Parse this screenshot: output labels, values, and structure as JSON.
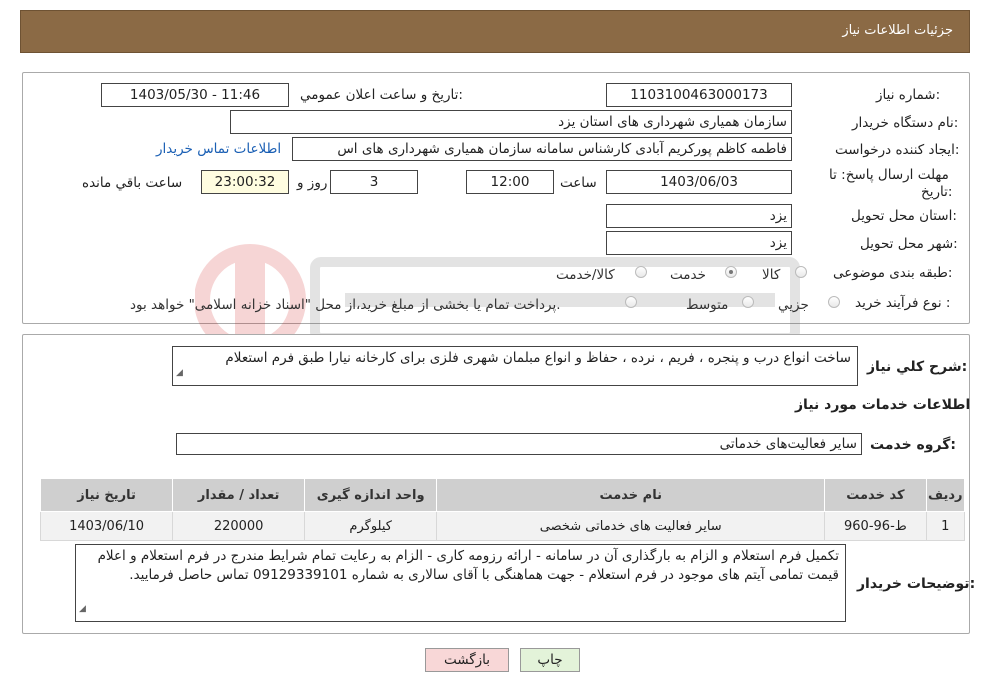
{
  "header": {
    "title": "جزئیات اطلاعات نیاز"
  },
  "form": {
    "need_number_label": "شماره نیاز:",
    "need_number": "1103100463000173",
    "announce_label": "تاریخ و ساعت اعلان عمومي:",
    "announce_value": "1403/05/30 - 11:46",
    "buyer_org_label": "نام دستگاه خريدار:",
    "buyer_org": "سازمان همیاری شهرداری های استان یزد",
    "creator_label": "ایجاد کننده درخواست:",
    "creator": "فاطمه کاظم پورکریم آبادی کارشناس سامانه سازمان همیاری شهرداری های اس",
    "contact_link": "اطلاعات تماس خریدار",
    "deadline_label_1": "مهلت ارسال پاسخ: تا",
    "deadline_label_2": "تاریخ:",
    "deadline_date": "1403/06/03",
    "time_label": "ساعت",
    "deadline_time": "12:00",
    "days_value": "3",
    "days_label": "روز و",
    "remaining_value": "23:00:32",
    "remaining_label": "ساعت باقي مانده",
    "province_label": "استان محل تحویل:",
    "province": "یزد",
    "city_label": "شهر محل تحویل:",
    "city": "یزد",
    "category_label": "طبقه بندی موضوعی:",
    "category_options": [
      "کالا",
      "خدمت",
      "کالا/خدمت"
    ],
    "category_selected": "خدمت",
    "process_label": "نوع فرآیند خرید :",
    "process_options": [
      "جزیي",
      "متوسط"
    ],
    "payment_note": "پرداخت تمام یا بخشی از مبلغ خرید،از محل \"اسناد خزانه اسلامی\" خواهد بود."
  },
  "summary": {
    "label": "شرح كلي نياز:",
    "text": "ساخت انواع درب و پنجره ، فریم ، نرده ، حفاظ و انواع مبلمان شهری فلزی برای کارخانه نیارا طبق فرم استعلام"
  },
  "services": {
    "section_title": "اطلاعات خدمات مورد نیاز",
    "group_label": "گروه خدمت:",
    "group_value": "سایر فعالیت‌های خدماتی",
    "columns": [
      "ردیف",
      "کد خدمت",
      "نام خدمت",
      "واحد اندازه گیری",
      "تعداد / مقدار",
      "تاریخ نیاز"
    ],
    "rows": [
      {
        "row": "1",
        "code": "ط-96-960",
        "name": "سایر فعالیت های خدماتی شخصی",
        "unit": "کیلوگرم",
        "qty": "220000",
        "date": "1403/06/10"
      }
    ]
  },
  "buyer_notes": {
    "label": "توضیحات خریدار:",
    "text": "تکمیل فرم استعلام و الزام به بارگذاری آن در سامانه - ارائه رزومه کاری - الزام به رعایت تمام شرایط مندرج در فرم استعلام و اعلام قیمت تمامی آیتم های موجود در فرم استعلام - جهت هماهنگی با آقای سالاری به شماره 09129339101 تماس حاصل فرمایید."
  },
  "buttons": {
    "print": "چاپ",
    "back": "بازگشت"
  },
  "colors": {
    "header_bg": "#8B6A45",
    "link": "#1a5fb4",
    "back_btn": "#f8d7d7",
    "print_btn": "#e3f3d9"
  }
}
